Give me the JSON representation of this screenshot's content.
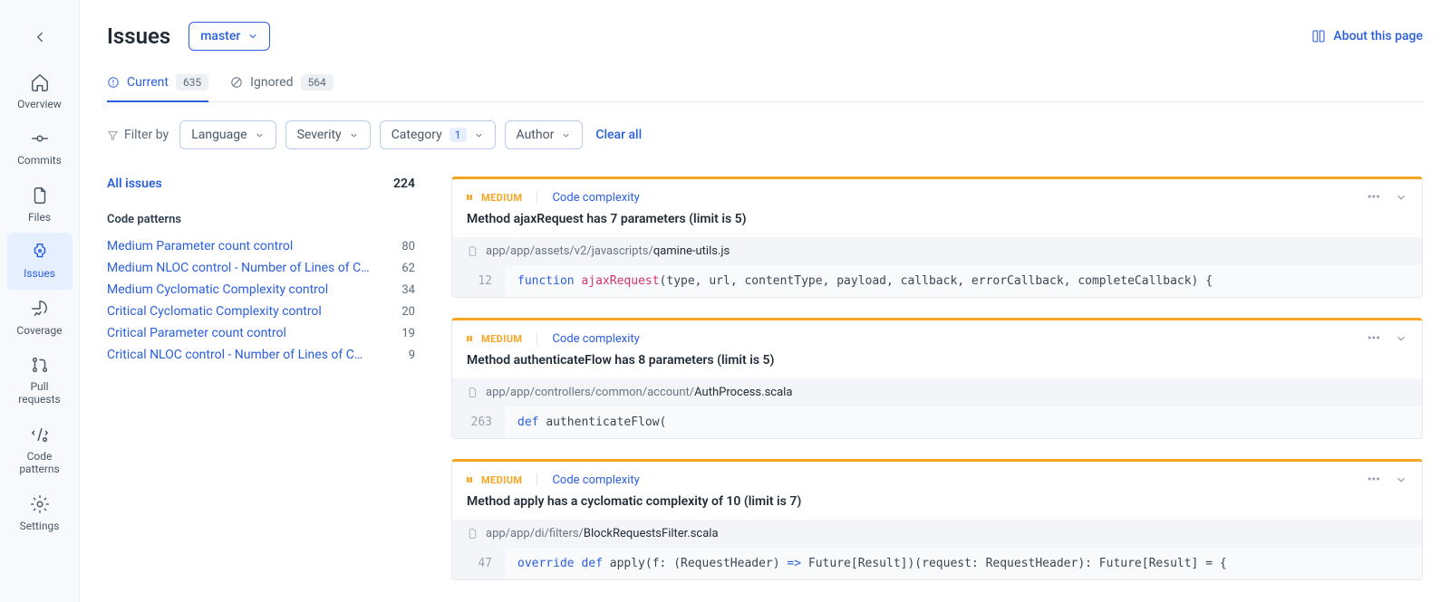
{
  "sidebar": {
    "items": [
      {
        "label": "Overview"
      },
      {
        "label": "Commits"
      },
      {
        "label": "Files"
      },
      {
        "label": "Issues"
      },
      {
        "label": "Coverage"
      },
      {
        "label": "Pull requests"
      },
      {
        "label": "Code patterns"
      },
      {
        "label": "Settings"
      }
    ]
  },
  "header": {
    "title": "Issues",
    "branch": "master",
    "about": "About this page"
  },
  "tabs": {
    "current": {
      "label": "Current",
      "count": "635"
    },
    "ignored": {
      "label": "Ignored",
      "count": "564"
    }
  },
  "filters": {
    "label": "Filter by",
    "language": "Language",
    "severity": "Severity",
    "category": "Category",
    "category_count": "1",
    "author": "Author",
    "clear": "Clear all"
  },
  "left": {
    "all_label": "All issues",
    "all_count": "224",
    "section": "Code patterns",
    "patterns": [
      {
        "name": "Medium Parameter count control",
        "count": "80"
      },
      {
        "name": "Medium NLOC control - Number of Lines of Cod…",
        "count": "62"
      },
      {
        "name": "Medium Cyclomatic Complexity control",
        "count": "34"
      },
      {
        "name": "Critical Cyclomatic Complexity control",
        "count": "20"
      },
      {
        "name": "Critical Parameter count control",
        "count": "19"
      },
      {
        "name": "Critical NLOC control - Number of Lines of Code (…",
        "count": "9"
      }
    ]
  },
  "issues": [
    {
      "severity": "MEDIUM",
      "category": "Code complexity",
      "title": "Method ajaxRequest has 7 parameters (limit is 5)",
      "path_prefix": "app/app/assets/v2/javascripts/",
      "path_file": "qamine-utils.js",
      "line": "12",
      "code_tokens": [
        {
          "t": "function ",
          "c": "tok-kw"
        },
        {
          "t": "ajaxRequest",
          "c": "tok-fn"
        },
        {
          "t": "(type, url, contentType, payload, callback, errorCallback, completeCallback) {",
          "c": ""
        }
      ]
    },
    {
      "severity": "MEDIUM",
      "category": "Code complexity",
      "title": "Method authenticateFlow has 8 parameters (limit is 5)",
      "path_prefix": "app/app/controllers/common/account/",
      "path_file": "AuthProcess.scala",
      "line": "263",
      "code_tokens": [
        {
          "t": "def ",
          "c": "tok-kw"
        },
        {
          "t": "authenticateFlow(",
          "c": ""
        }
      ]
    },
    {
      "severity": "MEDIUM",
      "category": "Code complexity",
      "title": "Method apply has a cyclomatic complexity of 10 (limit is 7)",
      "path_prefix": "app/app/di/filters/",
      "path_file": "BlockRequestsFilter.scala",
      "line": "47",
      "code_tokens": [
        {
          "t": "override def ",
          "c": "tok-kw"
        },
        {
          "t": "apply(f: (RequestHeader) ",
          "c": ""
        },
        {
          "t": "=>",
          "c": "tok-kw"
        },
        {
          "t": " Future[Result])(request: RequestHeader): Future[Result] = {",
          "c": ""
        }
      ]
    }
  ]
}
